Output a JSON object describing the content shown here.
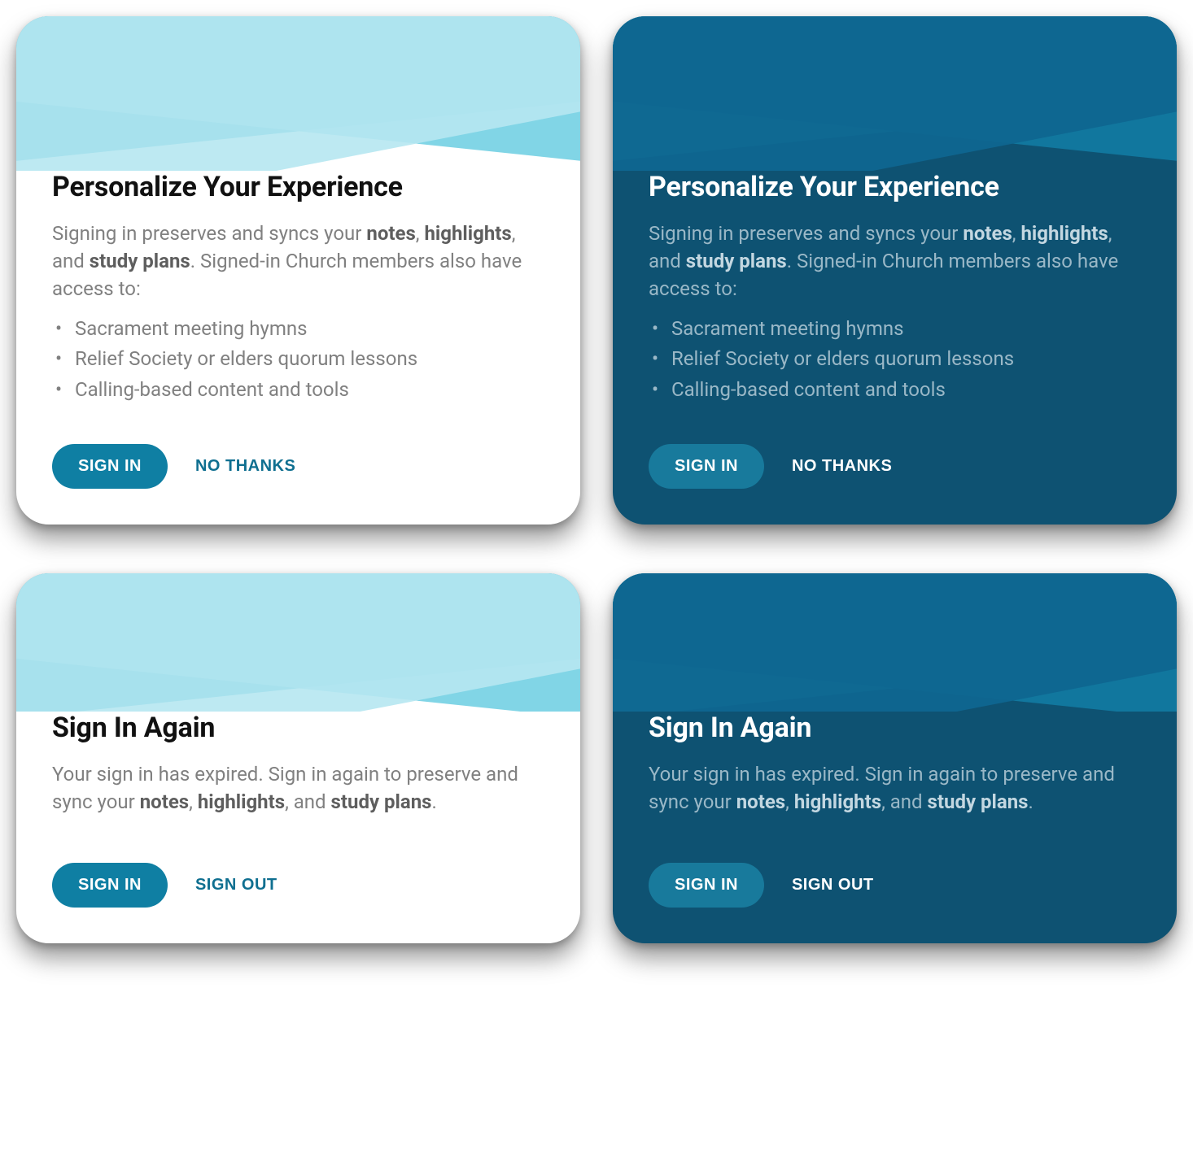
{
  "personalize": {
    "title": "Personalize Your Experience",
    "body_prefix": "Signing in preserves and syncs your ",
    "bold1": "notes",
    "sep1": ", ",
    "bold2": "highlights",
    "sep2": ", and ",
    "bold3": "study plans",
    "body_suffix": ". Signed-in Church members also have access to:",
    "features": [
      "Sacrament meeting hymns",
      "Relief Society or elders quorum lessons",
      "Calling-based content and tools"
    ],
    "primary": "SIGN IN",
    "secondary": "NO THANKS"
  },
  "signin_again": {
    "title": "Sign In Again",
    "body_prefix": "Your sign in has expired. Sign in again to preserve and sync your ",
    "bold1": "notes",
    "sep1": ", ",
    "bold2": "highlights",
    "sep2": ", and ",
    "bold3": "study plans",
    "body_suffix": ".",
    "primary": "SIGN IN",
    "secondary": "SIGN OUT"
  }
}
